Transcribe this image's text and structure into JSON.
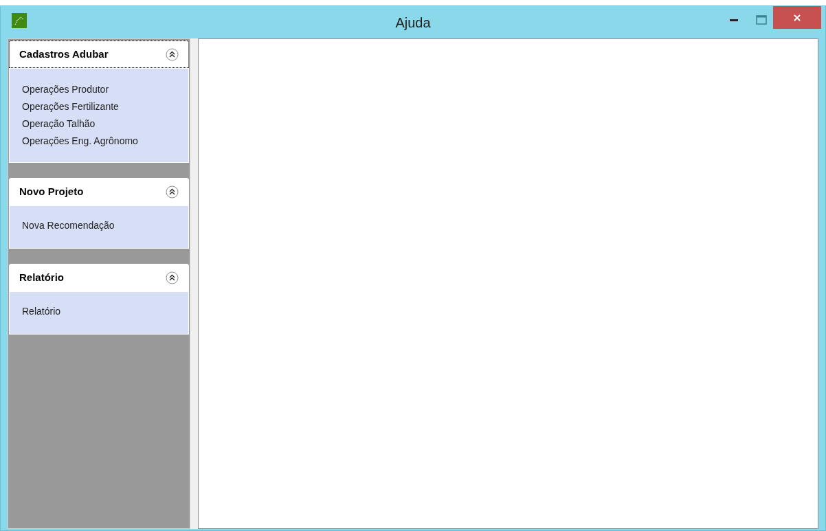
{
  "window": {
    "title": "Ajuda"
  },
  "sidebar": {
    "groups": [
      {
        "title": "Cadastros Adubar",
        "expanded": true,
        "focused": true,
        "items": [
          "Operações Produtor",
          "Operações Fertilizante",
          "Operação Talhão",
          "Operações Eng. Agrônomo"
        ]
      },
      {
        "title": "Novo Projeto",
        "expanded": true,
        "focused": false,
        "items": [
          "Nova Recomendação"
        ]
      },
      {
        "title": "Relatório",
        "expanded": true,
        "focused": false,
        "items": [
          "Relatório"
        ]
      }
    ]
  }
}
